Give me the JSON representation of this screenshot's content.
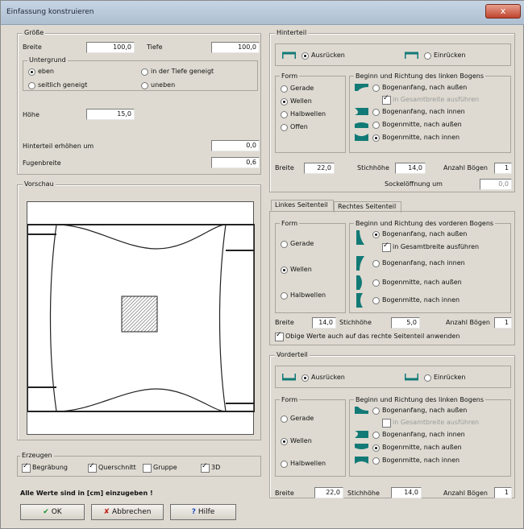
{
  "window": {
    "title": "Einfassung konstruieren",
    "close_glyph": "x"
  },
  "groesse": {
    "label": "Größe",
    "breite_label": "Breite",
    "breite_value": "100,0",
    "tiefe_label": "Tiefe",
    "tiefe_value": "100,0",
    "untergrund": {
      "label": "Untergrund",
      "options": [
        "eben",
        "in der Tiefe geneigt",
        "seitlich geneigt",
        "uneben"
      ],
      "selected": "eben"
    },
    "hoehe_label": "Höhe",
    "hoehe_value": "15,0",
    "hinterteil_erhoehen_label": "Hinterteil erhöhen um",
    "hinterteil_erhoehen_value": "0,0",
    "fugenbreite_label": "Fugenbreite",
    "fugenbreite_value": "0,6"
  },
  "vorschau": {
    "label": "Vorschau"
  },
  "erzeugen": {
    "label": "Erzeugen",
    "items": [
      {
        "label": "Begräbung",
        "checked": true
      },
      {
        "label": "Querschnitt",
        "checked": true
      },
      {
        "label": "Gruppe",
        "checked": false
      },
      {
        "label": "3D",
        "checked": true
      }
    ]
  },
  "note": "Alle Werte sind in [cm] einzugeben !",
  "buttons": {
    "ok": "OK",
    "cancel": "Abbrechen",
    "help": "Hilfe"
  },
  "hinterteil": {
    "label": "Hinterteil",
    "ausruecken": "Ausrücken",
    "einruecken": "Einrücken",
    "selected": "Ausrücken",
    "form_label": "Form",
    "form_options": [
      "Gerade",
      "Wellen",
      "Halbwellen",
      "Offen"
    ],
    "form_selected": "Wellen",
    "beginn_label": "Beginn und Richtung des linken Bogens",
    "beginn_options": [
      "Bogenanfang, nach außen",
      "in Gesamtbreite ausführen",
      "Bogenanfang, nach innen",
      "Bogenmitte, nach außen",
      "Bogenmitte, nach innen"
    ],
    "beginn_selected": "Bogenmitte, nach innen",
    "breite_label": "Breite",
    "breite_value": "22,0",
    "stichhoehe_label": "Stichhöhe",
    "stichhoehe_value": "14,0",
    "anzahl_label": "Anzahl Bögen",
    "anzahl_value": "1",
    "sockel_label": "Sockelöffnung um",
    "sockel_value": "0,0"
  },
  "seitenteil": {
    "tabs": [
      "Linkes Seitenteil",
      "Rechtes Seitenteil"
    ],
    "form_label": "Form",
    "form_options": [
      "Gerade",
      "Wellen",
      "Halbwellen"
    ],
    "form_selected": "Wellen",
    "beginn_label": "Beginn und Richtung des vorderen Bogens",
    "beginn_options": [
      "Bogenanfang, nach außen",
      "in Gesamtbreite ausführen",
      "Bogenanfang, nach innen",
      "Bogenmitte, nach außen",
      "Bogenmitte, nach innen"
    ],
    "beginn_selected": "Bogenanfang, nach außen",
    "breite_label": "Breite",
    "breite_value": "14,0",
    "stichhoehe_label": "Stichhöhe",
    "stichhoehe_value": "5,0",
    "anzahl_label": "Anzahl Bögen",
    "anzahl_value": "1",
    "rechte_label": "Obige Werte auch auf das rechte Seitenteil anwenden"
  },
  "vorderteil": {
    "label": "Vorderteil",
    "ausruecken": "Ausrücken",
    "einruecken": "Einrücken",
    "selected": "Ausrücken",
    "form_label": "Form",
    "form_options": [
      "Gerade",
      "Wellen",
      "Halbwellen"
    ],
    "form_selected": "Wellen",
    "beginn_label": "Beginn und Richtung des linken Bogens",
    "beginn_options": [
      "Bogenanfang, nach außen",
      "in Gesamtbreite ausführen",
      "Bogenanfang, nach innen",
      "Bogenmitte, nach außen",
      "Bogenmitte, nach innen"
    ],
    "beginn_selected": "Bogenmitte, nach außen",
    "breite_label": "Breite",
    "breite_value": "22,0",
    "stichhoehe_label": "Stichhöhe",
    "stichhoehe_value": "14,0",
    "anzahl_label": "Anzahl Bögen",
    "anzahl_value": "1"
  },
  "colors": {
    "accent": "#127a76",
    "title_bg": "#b9c9da"
  }
}
